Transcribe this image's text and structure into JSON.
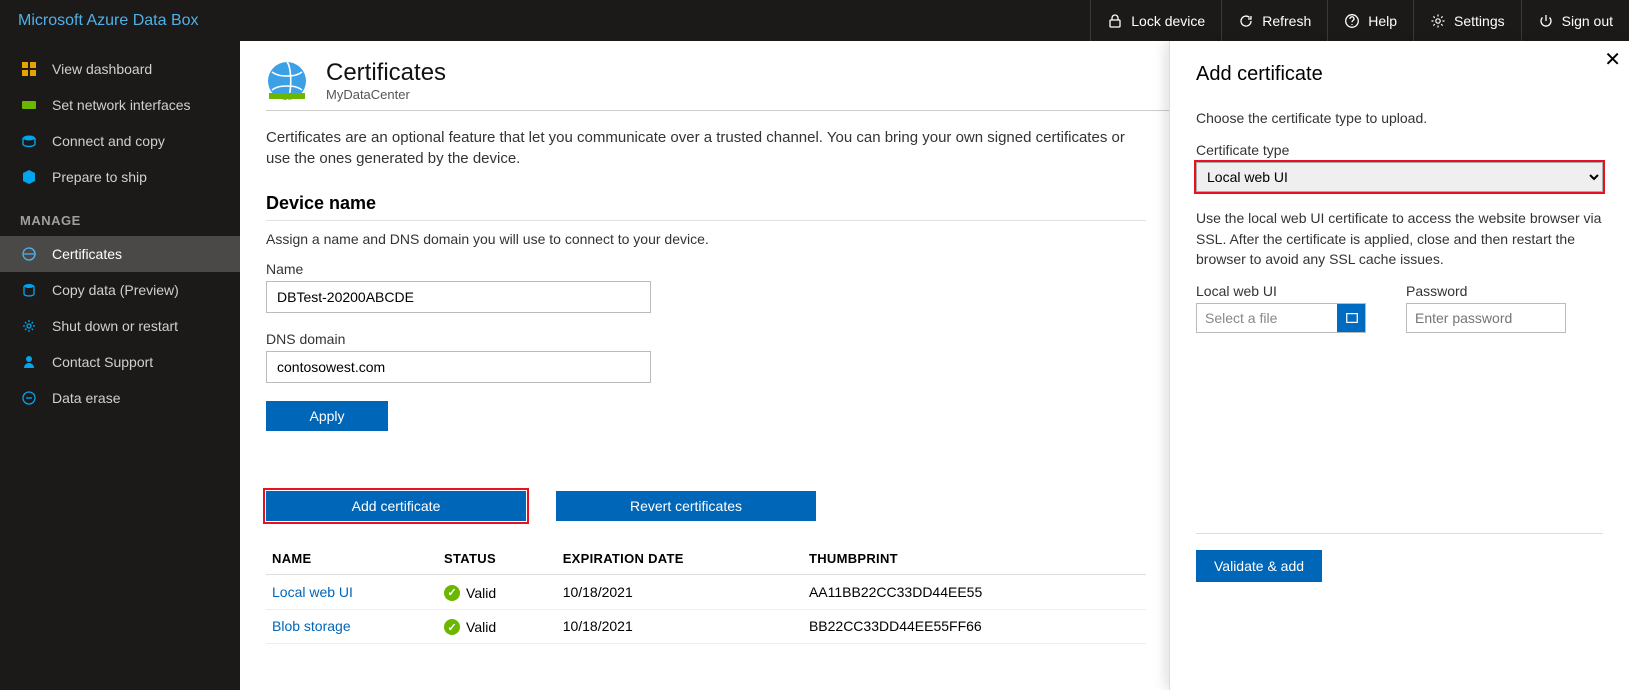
{
  "brand": "Microsoft Azure Data Box",
  "topbar": {
    "lock": "Lock device",
    "refresh": "Refresh",
    "help": "Help",
    "settings": "Settings",
    "signout": "Sign out"
  },
  "sidebar": {
    "items": [
      {
        "label": "View dashboard"
      },
      {
        "label": "Set network interfaces"
      },
      {
        "label": "Connect and copy"
      },
      {
        "label": "Prepare to ship"
      }
    ],
    "manage_heading": "MANAGE",
    "manage": [
      {
        "label": "Certificates",
        "active": true
      },
      {
        "label": "Copy data (Preview)"
      },
      {
        "label": "Shut down or restart"
      },
      {
        "label": "Contact Support"
      },
      {
        "label": "Data erase"
      }
    ]
  },
  "page": {
    "title": "Certificates",
    "subtitle": "MyDataCenter",
    "description": "Certificates are an optional feature that let you communicate over a trusted channel. You can bring your own signed certificates or use the ones generated by the device.",
    "device_section": "Device name",
    "device_sub": "Assign a name and DNS domain you will use to connect to your device.",
    "name_label": "Name",
    "name_value": "DBTest-20200ABCDE",
    "dns_label": "DNS domain",
    "dns_value": "contosowest.com",
    "apply": "Apply",
    "add_cert": "Add certificate",
    "revert": "Revert certificates"
  },
  "table": {
    "headers": {
      "name": "NAME",
      "status": "STATUS",
      "exp": "EXPIRATION DATE",
      "thumb": "THUMBPRINT"
    },
    "rows": [
      {
        "name": "Local web UI",
        "status": "Valid",
        "exp": "10/18/2021",
        "thumb": "AA11BB22CC33DD44EE55"
      },
      {
        "name": "Blob storage",
        "status": "Valid",
        "exp": "10/18/2021",
        "thumb": "BB22CC33DD44EE55FF66"
      }
    ]
  },
  "panel": {
    "title": "Add certificate",
    "intro": "Choose the certificate type to upload.",
    "type_label": "Certificate type",
    "type_value": "Local web UI",
    "type_help": "Use the local web UI certificate to access the website browser via SSL. After the certificate is applied, close and then restart the browser to avoid any SSL cache issues.",
    "file_label": "Local web UI",
    "file_placeholder": "Select a file",
    "pw_label": "Password",
    "pw_placeholder": "Enter password",
    "validate": "Validate & add"
  }
}
